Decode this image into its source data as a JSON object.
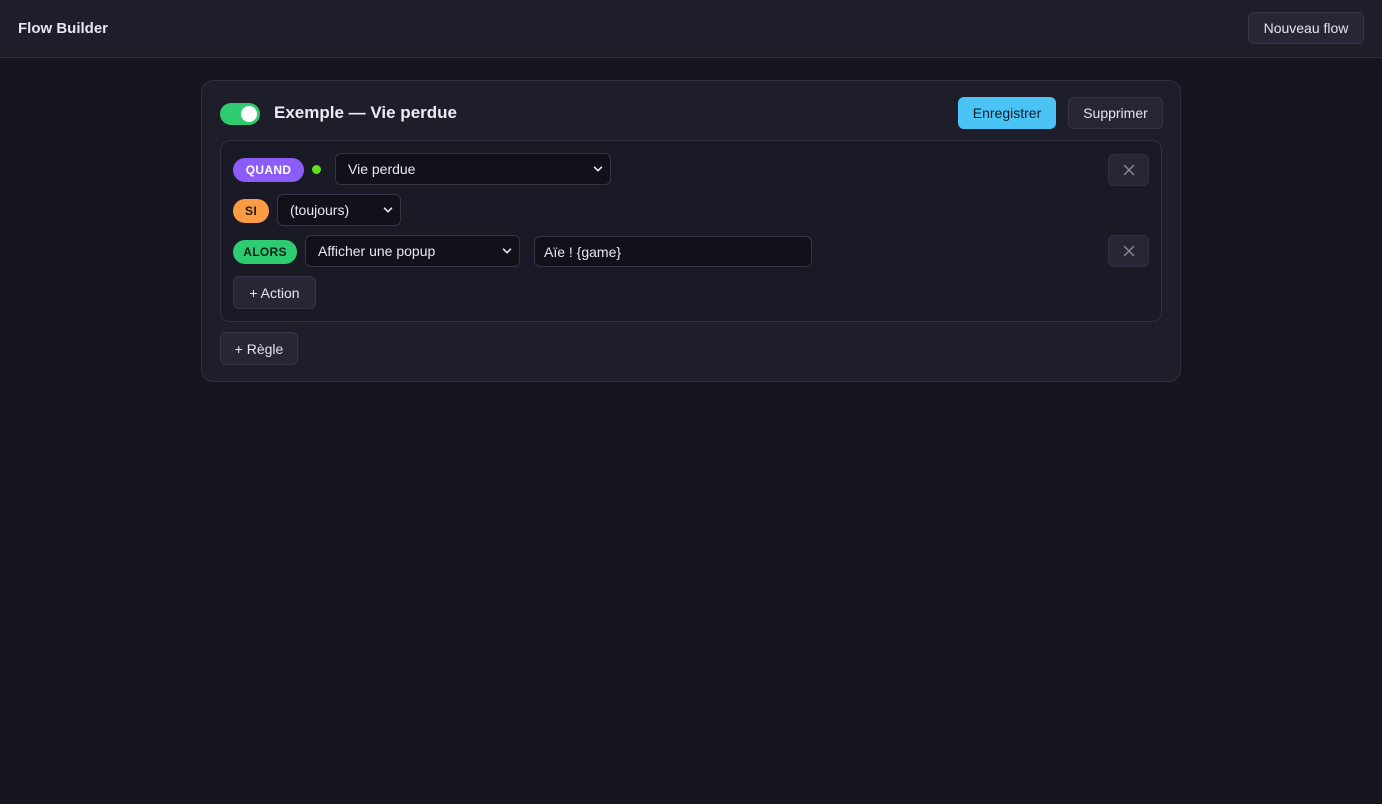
{
  "header": {
    "title": "Flow Builder",
    "new_flow_label": "Nouveau flow"
  },
  "flow": {
    "enabled": true,
    "title": "Exemple — Vie perdue",
    "save_label": "Enregistrer",
    "delete_label": "Supprimer",
    "add_rule_label": "+ Règle",
    "rule": {
      "when_badge": "QUAND",
      "if_badge": "SI",
      "then_badge": "ALORS",
      "trigger_value": "Vie perdue",
      "condition_value": "(toujours)",
      "action_value": "Afficher une popup",
      "action_param_value": "Aïe ! {game}",
      "add_action_label": "+ Action"
    }
  },
  "colors": {
    "accent": "#4ac3f5",
    "when": "#8b5cf6",
    "if": "#fb9c45",
    "then": "#2ecc71",
    "status_dot": "#5fe21a"
  }
}
